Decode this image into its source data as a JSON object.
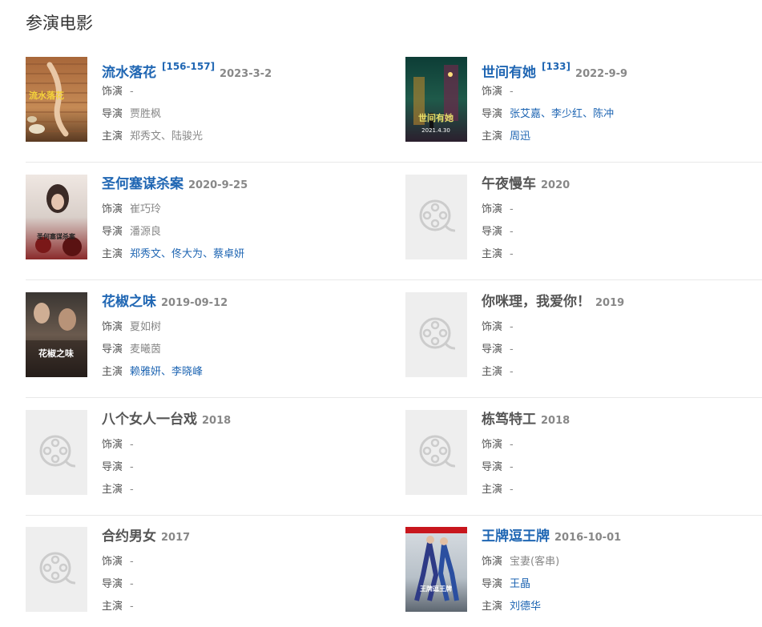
{
  "section": {
    "title": "参演电影"
  },
  "labels": {
    "role": "饰演",
    "director": "导演",
    "cast": "主演",
    "separator": "、"
  },
  "movies": [
    {
      "title": "流水落花",
      "linked": true,
      "ref": "[156-157]",
      "date": "2023-3-2",
      "role": "-",
      "director": [
        {
          "name": "贾胜枫",
          "linked": false
        }
      ],
      "cast": [
        {
          "name": "郑秀文",
          "linked": false
        },
        {
          "name": "陆骏光",
          "linked": false
        }
      ],
      "poster": "poster-1",
      "poster_text": "流水落花"
    },
    {
      "title": "世间有她",
      "linked": true,
      "ref": "[133]",
      "date": "2022-9-9",
      "role": "-",
      "director": [
        {
          "name": "张艾嘉",
          "linked": true
        },
        {
          "name": "李少红",
          "linked": true
        },
        {
          "name": "陈冲",
          "linked": true
        }
      ],
      "cast": [
        {
          "name": "周迅",
          "linked": true
        }
      ],
      "poster": "poster-2",
      "poster_text": "世间有她",
      "poster_sub": "2021.4.30"
    },
    {
      "title": "圣何塞谋杀案",
      "linked": true,
      "ref": "",
      "date": "2020-9-25",
      "role": "崔巧玲",
      "director": [
        {
          "name": "潘源良",
          "linked": false
        }
      ],
      "cast": [
        {
          "name": "郑秀文",
          "linked": true
        },
        {
          "name": "佟大为",
          "linked": true
        },
        {
          "name": "蔡卓妍",
          "linked": true
        }
      ],
      "poster": "poster-3",
      "poster_text": "圣何塞谋杀案"
    },
    {
      "title": "午夜慢车",
      "linked": false,
      "ref": "",
      "date": "2020",
      "role": "-",
      "director": [
        {
          "name": "-",
          "linked": false
        }
      ],
      "cast": [
        {
          "name": "-",
          "linked": false
        }
      ],
      "poster": "placeholder"
    },
    {
      "title": "花椒之味",
      "linked": true,
      "ref": "",
      "date": "2019-09-12",
      "role": "夏如树",
      "director": [
        {
          "name": "麦曦茵",
          "linked": false
        }
      ],
      "cast": [
        {
          "name": "赖雅妍",
          "linked": true
        },
        {
          "name": "李晓峰",
          "linked": true
        }
      ],
      "poster": "poster-5",
      "poster_text": "花椒之味"
    },
    {
      "title": "你咪理，我爱你！",
      "linked": false,
      "ref": "",
      "date": "2019",
      "role": "-",
      "director": [
        {
          "name": "-",
          "linked": false
        }
      ],
      "cast": [
        {
          "name": "-",
          "linked": false
        }
      ],
      "poster": "placeholder"
    },
    {
      "title": "八个女人一台戏",
      "linked": false,
      "ref": "",
      "date": "2018",
      "role": "-",
      "director": [
        {
          "name": "-",
          "linked": false
        }
      ],
      "cast": [
        {
          "name": "-",
          "linked": false
        }
      ],
      "poster": "placeholder"
    },
    {
      "title": "栋笃特工",
      "linked": false,
      "ref": "",
      "date": "2018",
      "role": "-",
      "director": [
        {
          "name": "-",
          "linked": false
        }
      ],
      "cast": [
        {
          "name": "-",
          "linked": false
        }
      ],
      "poster": "placeholder"
    },
    {
      "title": "合约男女",
      "linked": false,
      "ref": "",
      "date": "2017",
      "role": "-",
      "director": [
        {
          "name": "-",
          "linked": false
        }
      ],
      "cast": [
        {
          "name": "-",
          "linked": false
        }
      ],
      "poster": "placeholder"
    },
    {
      "title": "王牌逗王牌",
      "linked": true,
      "ref": "",
      "date": "2016-10-01",
      "role": "宝妻(客串)",
      "director": [
        {
          "name": "王晶",
          "linked": true
        }
      ],
      "cast": [
        {
          "name": "刘德华",
          "linked": true
        }
      ],
      "poster": "poster-10",
      "poster_text": "王牌逗王牌"
    }
  ],
  "colors": {
    "link": "#1f66b3",
    "muted": "#888888",
    "label": "#555555",
    "placeholder_bg": "#eeeeee",
    "icon": "#cccccc"
  }
}
